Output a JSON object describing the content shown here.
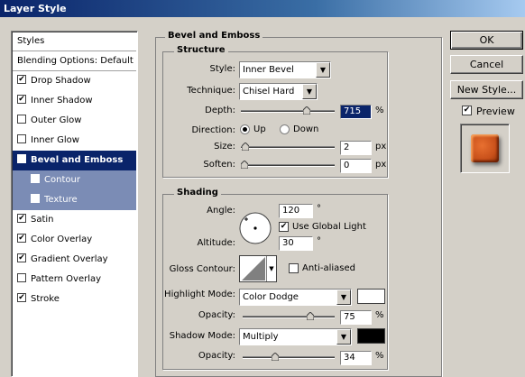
{
  "window": {
    "title": "Layer Style"
  },
  "styles_list": {
    "header": "Styles",
    "blending": "Blending Options: Default",
    "items": [
      {
        "label": "Drop Shadow",
        "checked": true
      },
      {
        "label": "Inner Shadow",
        "checked": true
      },
      {
        "label": "Outer Glow",
        "checked": false
      },
      {
        "label": "Inner Glow",
        "checked": false
      },
      {
        "label": "Bevel and Emboss",
        "checked": true,
        "selected": true
      },
      {
        "label": "Contour",
        "checked": true,
        "sub": true
      },
      {
        "label": "Texture",
        "checked": true,
        "sub": true
      },
      {
        "label": "Satin",
        "checked": true
      },
      {
        "label": "Color Overlay",
        "checked": true
      },
      {
        "label": "Gradient Overlay",
        "checked": true
      },
      {
        "label": "Pattern Overlay",
        "checked": false
      },
      {
        "label": "Stroke",
        "checked": true
      }
    ]
  },
  "bevel": {
    "title": "Bevel and Emboss",
    "structure": {
      "title": "Structure",
      "style_label": "Style:",
      "style_value": "Inner Bevel",
      "technique_label": "Technique:",
      "technique_value": "Chisel Hard",
      "depth_label": "Depth:",
      "depth_value": "715",
      "depth_unit": "%",
      "depth_level": 0.72,
      "direction_label": "Direction:",
      "up_label": "Up",
      "down_label": "Down",
      "direction": "Up",
      "size_label": "Size:",
      "size_value": "2",
      "size_unit": "px",
      "size_level": 0.01,
      "soften_label": "Soften:",
      "soften_value": "0",
      "soften_unit": "px",
      "soften_level": 0
    },
    "shading": {
      "title": "Shading",
      "angle_label": "Angle:",
      "angle_value": "120",
      "angle_unit": "°",
      "global_light_label": "Use Global Light",
      "global_light": true,
      "altitude_label": "Altitude:",
      "altitude_value": "30",
      "altitude_unit": "°",
      "gloss_label": "Gloss Contour:",
      "anti_aliased_label": "Anti-aliased",
      "anti_aliased": false,
      "highlight_label": "Highlight Mode:",
      "highlight_value": "Color Dodge",
      "highlight_color": "#ffffff",
      "hl_opacity_label": "Opacity:",
      "hl_opacity_value": "75",
      "hl_opacity_unit": "%",
      "hl_opacity_level": 0.75,
      "shadow_label": "Shadow Mode:",
      "shadow_value": "Multiply",
      "shadow_color": "#000000",
      "sh_opacity_label": "Opacity:",
      "sh_opacity_value": "34",
      "sh_opacity_unit": "%",
      "sh_opacity_level": 0.34
    }
  },
  "buttons": {
    "ok": "OK",
    "cancel": "Cancel",
    "new_style": "New Style..."
  },
  "preview": {
    "label": "Preview",
    "checked": true,
    "swatch_color": "#c8501a"
  },
  "icons": {
    "check": "✔",
    "arrow": "▼"
  }
}
